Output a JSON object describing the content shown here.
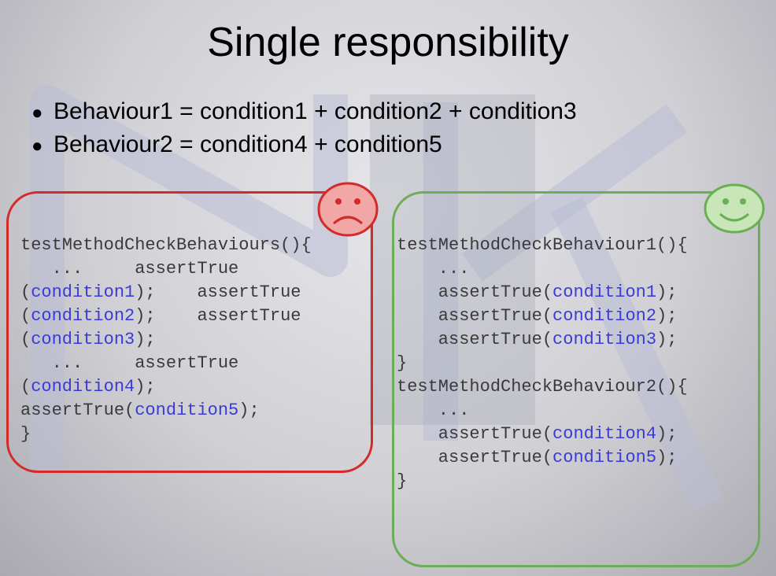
{
  "slide": {
    "title": "Single responsibility",
    "bullets": [
      "Behaviour1 = condition1 + condition2 + condition3",
      "Behaviour2 = condition4 + condition5"
    ],
    "bad_example": {
      "icon": "sad-face-icon",
      "border_color": "#d42a2a",
      "lines": [
        [
          "testMethodCheckBehaviours(){",
          ""
        ],
        [
          "   ...     assertTrue",
          ""
        ],
        [
          "(",
          "condition1",
          ");    assertTrue"
        ],
        [
          "(",
          "condition2",
          ");    assertTrue"
        ],
        [
          "(",
          "condition3",
          ");"
        ],
        [
          "   ...     assertTrue",
          ""
        ],
        [
          "(",
          "condition4",
          ");"
        ],
        [
          "assertTrue(",
          "condition5",
          ");"
        ],
        [
          "}",
          ""
        ]
      ]
    },
    "good_example": {
      "icon": "happy-face-icon",
      "border_color": "#6aaf55",
      "lines": [
        [
          "testMethodCheckBehaviour1(){",
          ""
        ],
        [
          "    ...",
          ""
        ],
        [
          "    assertTrue(",
          "condition1",
          ");"
        ],
        [
          "    assertTrue(",
          "condition2",
          ");"
        ],
        [
          "    assertTrue(",
          "condition3",
          ");"
        ],
        [
          "}",
          ""
        ],
        [
          "testMethodCheckBehaviour2(){",
          ""
        ],
        [
          "    ...",
          ""
        ],
        [
          "    assertTrue(",
          "condition4",
          ");"
        ],
        [
          "    assertTrue(",
          "condition5",
          ");"
        ],
        [
          "}",
          ""
        ]
      ]
    },
    "variable_color": "#3a3ad8"
  }
}
